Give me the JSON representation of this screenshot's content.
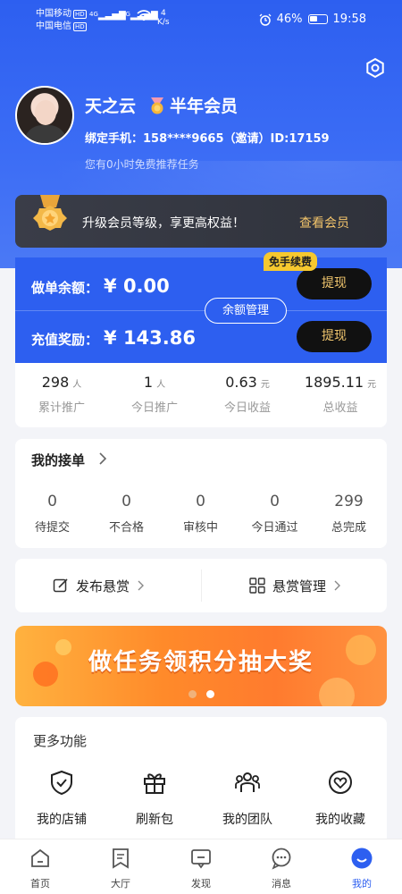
{
  "status_bar": {
    "carrier1": "中国移动",
    "carrier2": "中国电信",
    "hd": "HD",
    "net1": "4G",
    "net2": "4G",
    "speed_value": "4",
    "speed_unit": "K/s",
    "battery": "46%",
    "time": "19:58"
  },
  "profile": {
    "name": "天之云",
    "membership": "半年会员",
    "phone_line": "绑定手机：158****9665（邀请）ID:17159",
    "free_task": "您有0小时免费推荐任务"
  },
  "vip_bar": {
    "text": "升级会员等级，享更高权益！",
    "link": "查看会员"
  },
  "balance": {
    "order_label": "做单余额：",
    "order_value": "¥ 0.00",
    "recharge_label": "充值奖励：",
    "recharge_value": "¥ 143.86",
    "withdraw1": "提现",
    "withdraw2": "提现",
    "free_renew_tag": "免手续费",
    "manage": "余额管理"
  },
  "stats": [
    {
      "value": "298",
      "unit": "人",
      "label": "累计推广"
    },
    {
      "value": "1",
      "unit": "人",
      "label": "今日推广"
    },
    {
      "value": "0.63",
      "unit": "元",
      "label": "今日收益"
    },
    {
      "value": "1895.11",
      "unit": "元",
      "label": "总收益"
    }
  ],
  "orders": {
    "title": "我的接单",
    "items": [
      {
        "value": "0",
        "label": "待提交"
      },
      {
        "value": "0",
        "label": "不合格"
      },
      {
        "value": "0",
        "label": "审核中"
      },
      {
        "value": "0",
        "label": "今日通过"
      },
      {
        "value": "299",
        "label": "总完成"
      }
    ]
  },
  "publish": {
    "publish_label": "发布悬赏",
    "manage_label": "悬赏管理"
  },
  "banner": {
    "text": "做任务领积分抽大奖",
    "dot_active_color": "#ffffff",
    "dot_inactive_color": "#f0b27a"
  },
  "more": {
    "title": "更多功能",
    "items": [
      {
        "label": "我的店铺",
        "icon": "shop-shield-icon"
      },
      {
        "label": "刷新包",
        "icon": "gift-icon"
      },
      {
        "label": "我的团队",
        "icon": "team-icon"
      },
      {
        "label": "我的收藏",
        "icon": "heart-icon"
      }
    ]
  },
  "nav": [
    {
      "label": "首页",
      "icon": "home-icon"
    },
    {
      "label": "大厅",
      "icon": "bookmark-icon"
    },
    {
      "label": "发现",
      "icon": "discover-icon"
    },
    {
      "label": "消息",
      "icon": "message-icon"
    },
    {
      "label": "我的",
      "icon": "profile-icon"
    }
  ],
  "colors": {
    "primary": "#2d5ff0",
    "gold": "#f1c66e",
    "tag_yellow": "#f6c82f"
  }
}
